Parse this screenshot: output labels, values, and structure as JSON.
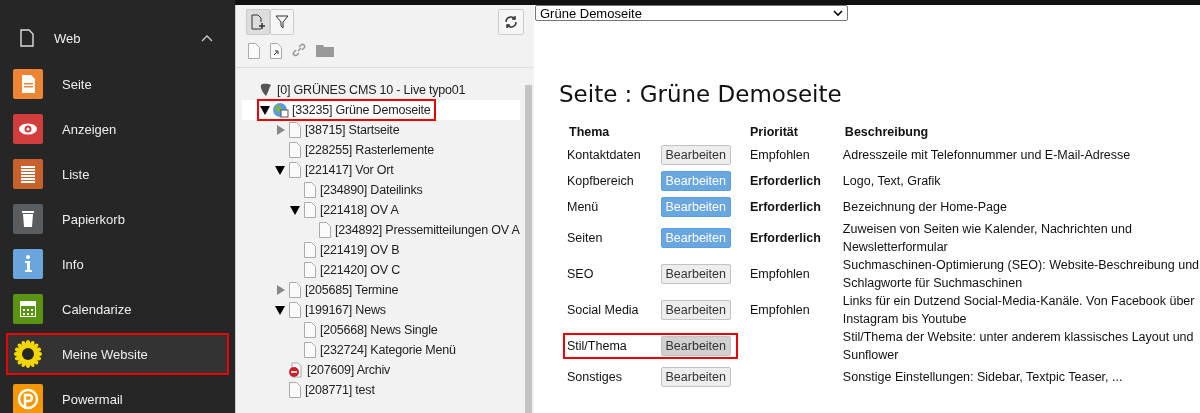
{
  "sidebar": {
    "group": {
      "label": "Web",
      "expanded": true
    },
    "items": [
      {
        "label": "Seite",
        "kind": "page",
        "color": "#ef8432",
        "selected": false,
        "highlighted": false
      },
      {
        "label": "Anzeigen",
        "kind": "view",
        "color": "#d13c3c",
        "selected": false,
        "highlighted": false
      },
      {
        "label": "Liste",
        "kind": "list",
        "color": "#c9612e",
        "selected": false,
        "highlighted": false
      },
      {
        "label": "Papierkorb",
        "kind": "trash",
        "color": "#5a5d60",
        "selected": false,
        "highlighted": false
      },
      {
        "label": "Info",
        "kind": "info",
        "color": "#6aa6dc",
        "selected": false,
        "highlighted": false
      },
      {
        "label": "Calendarize",
        "kind": "calendar",
        "color": "#5b9412",
        "selected": false,
        "highlighted": false
      },
      {
        "label": "Meine Website",
        "kind": "sunflower",
        "color": "#f2d600",
        "selected": true,
        "highlighted": true
      },
      {
        "label": "Powermail",
        "kind": "mail",
        "color": "#f49700",
        "selected": false,
        "highlighted": false
      }
    ]
  },
  "tree": {
    "nodes": [
      {
        "label": "[0] GRÜNES CMS 10 - Live typo01",
        "kind": "root",
        "children": [
          {
            "label": "[33235] Grüne Demoseite",
            "kind": "site",
            "expanded": true,
            "selected": true,
            "highlighted": true,
            "children": [
              {
                "label": "[38715] Startseite",
                "kind": "page",
                "expanded": false
              },
              {
                "label": "[228255] Rasterlemente",
                "kind": "page"
              },
              {
                "label": "[221417] Vor Ort",
                "kind": "page",
                "expanded": true,
                "children": [
                  {
                    "label": "[234890] Dateilinks",
                    "kind": "page"
                  },
                  {
                    "label": "[221418] OV A",
                    "kind": "page",
                    "expanded": true,
                    "children": [
                      {
                        "label": "[234892] Pressemitteilungen OV A",
                        "kind": "page"
                      }
                    ]
                  },
                  {
                    "label": "[221419] OV B",
                    "kind": "page"
                  },
                  {
                    "label": "[221420] OV C",
                    "kind": "page"
                  }
                ]
              },
              {
                "label": "[205685] Termine",
                "kind": "page",
                "expanded": false
              },
              {
                "label": "[199167] News",
                "kind": "page",
                "expanded": true,
                "children": [
                  {
                    "label": "[205668] News Single",
                    "kind": "page"
                  },
                  {
                    "label": "[232724] Kategorie Menü",
                    "kind": "page"
                  }
                ]
              },
              {
                "label": "[207609] Archiv",
                "kind": "restricted"
              },
              {
                "label": "[208771] test",
                "kind": "page"
              }
            ]
          }
        ]
      }
    ]
  },
  "content": {
    "site_select": {
      "value": "Grüne Demoseite"
    },
    "title": "Seite : Grüne Demoseite",
    "table": {
      "columns": [
        "Thema",
        "Priorität",
        "Beschreibung"
      ],
      "rows": [
        {
          "topic": "Kontaktdaten",
          "button": "Bearbeiten",
          "kind": "default",
          "pressed": false,
          "priority": "Empfohlen",
          "required": false,
          "description": "Adresszeile mit Telefonnummer und E-Mail-Adresse",
          "highlighted": false
        },
        {
          "topic": "Kopfbereich",
          "button": "Bearbeiten",
          "kind": "primary",
          "pressed": false,
          "priority": "Erforderlich",
          "required": true,
          "description": "Logo, Text, Grafik",
          "highlighted": false
        },
        {
          "topic": "Menü",
          "button": "Bearbeiten",
          "kind": "primary",
          "pressed": false,
          "priority": "Erforderlich",
          "required": true,
          "description": "Bezeichnung der Home-Page",
          "highlighted": false
        },
        {
          "topic": "Seiten",
          "button": "Bearbeiten",
          "kind": "primary",
          "pressed": false,
          "priority": "Erforderlich",
          "required": true,
          "description": "Zuweisen von Seiten wie Kalender, Nachrichten und Newsletterformular",
          "highlighted": false
        },
        {
          "topic": "SEO",
          "button": "Bearbeiten",
          "kind": "default",
          "pressed": false,
          "priority": "Empfohlen",
          "required": false,
          "description": "Suchmaschinen-Optimierung (SEO): Website-Beschreibung und Schlagworte für Suchmaschinen",
          "highlighted": false
        },
        {
          "topic": "Social Media",
          "button": "Bearbeiten",
          "kind": "default",
          "pressed": false,
          "priority": "Empfohlen",
          "required": false,
          "description": "Links für ein Dutzend Social-Media-Kanäle. Von Facebook über Instagram bis Youtube",
          "highlighted": false
        },
        {
          "topic": "Stil/Thema",
          "button": "Bearbeiten",
          "kind": "default",
          "pressed": true,
          "description": "Stil/Thema der Website: unter anderem klassisches Layout und Sunflower",
          "highlighted": true
        },
        {
          "topic": "Sonstiges",
          "button": "Bearbeiten",
          "kind": "default",
          "pressed": false,
          "description": "Sonstige Einstellungen: Sidebar, Textpic Teaser, ...",
          "highlighted": false
        }
      ]
    }
  }
}
